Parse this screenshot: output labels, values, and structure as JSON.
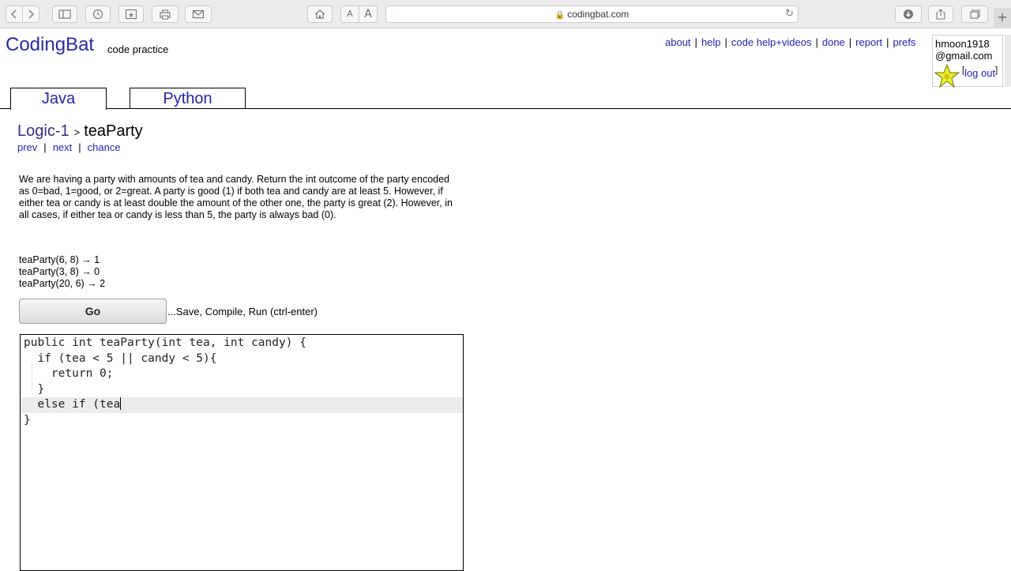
{
  "browser": {
    "url": "codingbat.com",
    "font_small_label": "A",
    "font_large_label": "A"
  },
  "site": {
    "logo": "CodingBat",
    "tagline": "code practice",
    "nav": [
      "about",
      "help",
      "code help+videos",
      "done",
      "report",
      "prefs"
    ],
    "user": {
      "email_line1": "hmoon1918",
      "email_line2": "@gmail.com",
      "logout": "log out"
    }
  },
  "tabs": [
    {
      "label": "Java",
      "active": true
    },
    {
      "label": "Python",
      "active": false
    }
  ],
  "problem": {
    "category": "Logic-1",
    "separator": ">",
    "name": "teaParty",
    "subnav": [
      "prev",
      "next",
      "chance"
    ],
    "description": "We are having a party with amounts of tea and candy. Return the int outcome of the party encoded as 0=bad, 1=good, or 2=great. A party is good (1) if both tea and candy are at least 5. However, if either tea or candy is at least double the amount of the other one, the party is great (2). However, in all cases, if either tea or candy is less than 5, the party is always bad (0).",
    "examples": [
      "teaParty(6, 8) → 1",
      "teaParty(3, 8) → 0",
      "teaParty(20, 6) → 2"
    ]
  },
  "controls": {
    "go_label": "Go",
    "go_note": "...Save, Compile, Run (ctrl-enter)"
  },
  "editor": {
    "lines": [
      "public int teaParty(int tea, int candy) {",
      "  if (tea < 5 || candy < 5){",
      "    return 0;",
      "  }",
      "  else if (tea",
      "}"
    ],
    "active_line": 4
  }
}
